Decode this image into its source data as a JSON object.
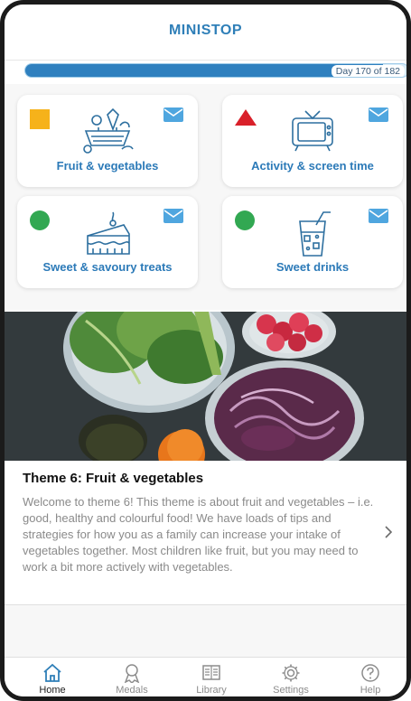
{
  "header": {
    "title": "MINISTOP"
  },
  "progress": {
    "label": "Day 170 of 182",
    "fraction": 0.934
  },
  "cards": [
    {
      "label": "Fruit & vegetables",
      "status": "yellow-square",
      "illustration": "fruit-basket-icon"
    },
    {
      "label": "Activity & screen time",
      "status": "red-triangle",
      "illustration": "tv-icon"
    },
    {
      "label": "Sweet & savoury treats",
      "status": "green-circle",
      "illustration": "cake-icon"
    },
    {
      "label": "Sweet drinks",
      "status": "green-circle",
      "illustration": "drink-glass-icon"
    }
  ],
  "theme": {
    "title": "Theme 6: Fruit & vegetables",
    "body": "Welcome to theme 6! This theme is about fruit and vegetables – i.e. good, healthy and colourful food! We have loads of tips and strategies for how you as a family can increase your intake of vegetables together. Most children like fruit, but you may need to work a bit more actively with vegetables."
  },
  "tabs": [
    {
      "label": "Home",
      "icon": "home-icon",
      "active": true
    },
    {
      "label": "Medals",
      "icon": "medal-icon",
      "active": false
    },
    {
      "label": "Library",
      "icon": "book-icon",
      "active": false
    },
    {
      "label": "Settings",
      "icon": "gear-icon",
      "active": false
    },
    {
      "label": "Help",
      "icon": "help-icon",
      "active": false
    }
  ],
  "colors": {
    "accent": "#2f7fb8",
    "status_yellow": "#f6b21a",
    "status_red": "#d9202a",
    "status_green": "#32a852"
  }
}
